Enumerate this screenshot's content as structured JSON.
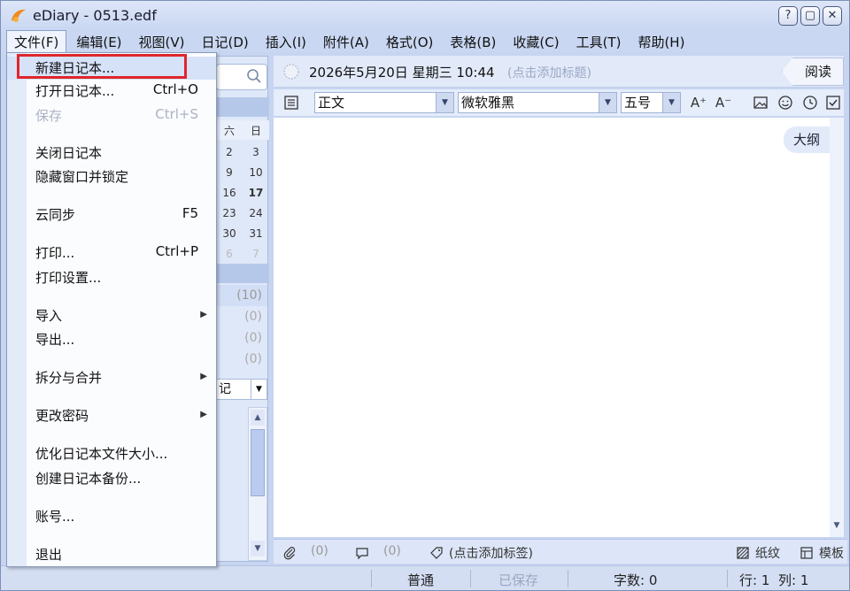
{
  "window": {
    "title": "eDiary - 0513.edf",
    "controls": [
      "?",
      "▢",
      "✕"
    ]
  },
  "menubar": [
    "文件(F)",
    "编辑(E)",
    "视图(V)",
    "日记(D)",
    "插入(I)",
    "附件(A)",
    "格式(O)",
    "表格(B)",
    "收藏(C)",
    "工具(T)",
    "帮助(H)"
  ],
  "file_menu": {
    "items": [
      {
        "label": "新建日记本...",
        "shortcut": "",
        "disabled": false,
        "submenu": false,
        "highlighted": true
      },
      {
        "label": "打开日记本...",
        "shortcut": "Ctrl+O",
        "disabled": false,
        "submenu": false
      },
      {
        "label": "保存",
        "shortcut": "Ctrl+S",
        "disabled": true,
        "submenu": false
      },
      {
        "label": "关闭日记本",
        "shortcut": "",
        "disabled": false,
        "submenu": false
      },
      {
        "label": "隐藏窗口并锁定",
        "shortcut": "",
        "disabled": false,
        "submenu": false
      },
      {
        "label": "云同步",
        "shortcut": "F5",
        "disabled": false,
        "submenu": false
      },
      {
        "label": "打印...",
        "shortcut": "Ctrl+P",
        "disabled": false,
        "submenu": false
      },
      {
        "label": "打印设置...",
        "shortcut": "",
        "disabled": false,
        "submenu": false
      },
      {
        "label": "导入",
        "shortcut": "",
        "disabled": false,
        "submenu": true
      },
      {
        "label": "导出...",
        "shortcut": "",
        "disabled": false,
        "submenu": false
      },
      {
        "label": "拆分与合并",
        "shortcut": "",
        "disabled": false,
        "submenu": true
      },
      {
        "label": "更改密码",
        "shortcut": "",
        "disabled": false,
        "submenu": true
      },
      {
        "label": "优化日记本文件大小...",
        "shortcut": "",
        "disabled": false,
        "submenu": false
      },
      {
        "label": "创建日记本备份...",
        "shortcut": "",
        "disabled": false,
        "submenu": false
      },
      {
        "label": "账号...",
        "shortcut": "",
        "disabled": false,
        "submenu": false
      },
      {
        "label": "退出",
        "shortcut": "",
        "disabled": false,
        "submenu": false
      }
    ]
  },
  "calendar": {
    "week_labels": [
      "六",
      "日"
    ],
    "rows": [
      [
        "2",
        "3"
      ],
      [
        "9",
        "10"
      ],
      [
        "16",
        "17"
      ],
      [
        "23",
        "24"
      ],
      [
        "30",
        "31"
      ],
      [
        "6",
        "7"
      ]
    ],
    "bold_day": "17"
  },
  "counts": [
    "(10)",
    "(0)",
    "(0)",
    "(0)"
  ],
  "diary_combo": "记",
  "main": {
    "date": "2026年5月20日 星期三 10:44",
    "title_placeholder": "(点击添加标题)",
    "read_tab": "阅读",
    "outline_tab": "大纲",
    "style_combo": "正文",
    "font_combo": "微软雅黑",
    "size_combo": "五号"
  },
  "bottombar": {
    "attach_count": "(0)",
    "comment_count": "(0)",
    "tag_placeholder": "(点击添加标签)",
    "paper": "纸纹",
    "template": "模板"
  },
  "statusbar": {
    "mode": "普通",
    "saved": "已保存",
    "word_count": "字数: 0",
    "row": "行: 1",
    "col": "列: 1"
  }
}
